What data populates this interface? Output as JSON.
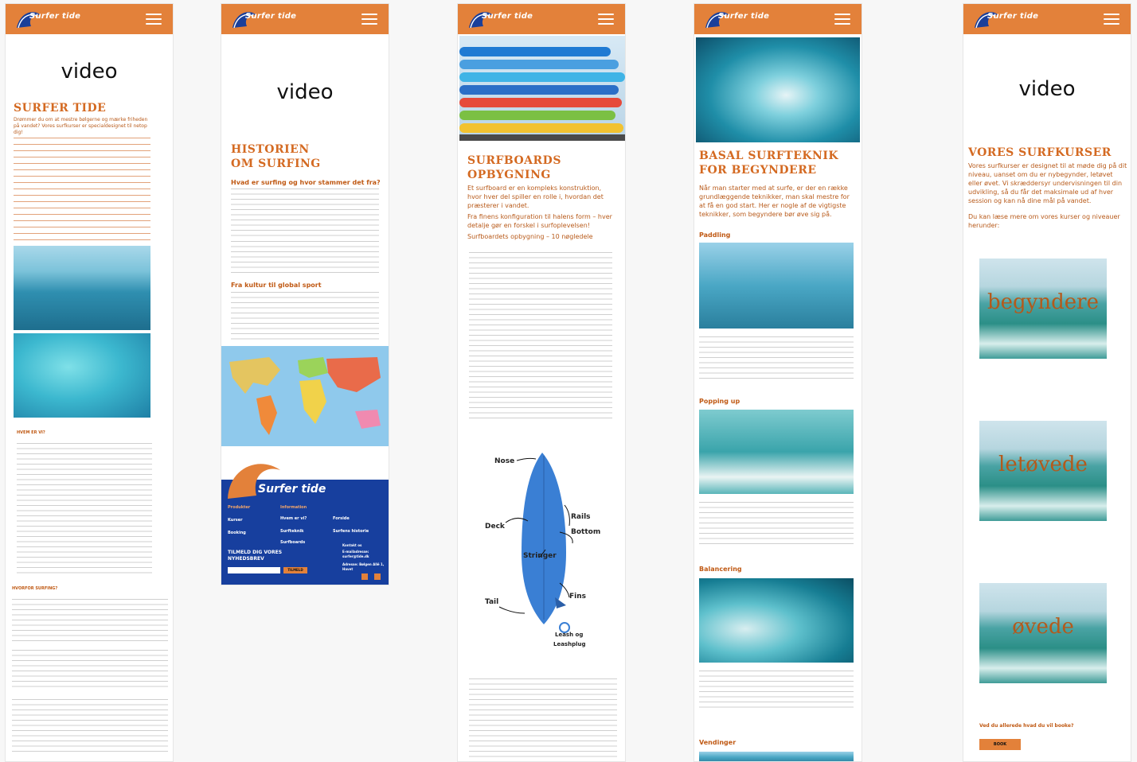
{
  "brand": {
    "name": "Surfer tide"
  },
  "screens": {
    "s1": {
      "video_label": "video",
      "title": "SURFER TIDE",
      "intro": "Drømmer du om at mestre bølgerne og mærke friheden på vandet? Vores surfkurser er specialdesignet til netop dig!",
      "heading_who": "HVEM ER VI?",
      "heading_why": "HVORFOR SURFING?"
    },
    "s2": {
      "video_label": "video",
      "title": "HISTORIEN OM SURFING",
      "sub1": "Hvad er surfing og hvor stammer det fra?",
      "sub2": "Fra kultur til global sport",
      "footer": {
        "col1_head": "Produkter",
        "col1": [
          "Kurser",
          "Booking"
        ],
        "col2_head": "Information",
        "col2": [
          "Hvem er vi?",
          "Surfteknik",
          "Surfboards"
        ],
        "col3": [
          "Forside",
          "Surfens historie"
        ],
        "newsletter": "TILMELD DIG VORES NYHEDSBREV",
        "newsletter_btn": "TILMELD",
        "contact_head": "Kontakt os",
        "email_label": "E-mailadresse:",
        "email": "surfer@tide.dk",
        "address_label": "Adresse: Bølgen Allé 1,",
        "address2": "Havet"
      }
    },
    "s3": {
      "title": "SURFBOARDS OPBYGNING",
      "intro": "Et surfboard er en kompleks konstruktion, hvor hver del spiller en rolle i, hvordan det præsterer i vandet.",
      "intro2": "Fra finens konfiguration til halens form – hver detalje gør en forskel i surfoplevelsen!",
      "intro3": "Surfboardets opbygning – 10 nøgledele",
      "diagram_labels": [
        "Nose",
        "Deck",
        "Rails",
        "Bottom",
        "Stringer",
        "Fins",
        "Tail",
        "Leash og",
        "Leashplug"
      ]
    },
    "s4": {
      "title": "BASAL SURFTEKNIK FOR BEGYNDERE",
      "intro": "Når man starter med at surfe, er der en række grundlæggende teknikker, man skal mestre for at få en god start. Her er nogle af de vigtigste teknikker, som begyndere bør øve sig på.",
      "sections": [
        "Paddling",
        "Popping up",
        "Balancering",
        "Vendinger"
      ]
    },
    "s5": {
      "video_label": "video",
      "title": "VORES SURFKURSER",
      "intro": "Vores surfkurser er designet til at møde dig på dit niveau, uanset om du er nybegynder, letøvet eller øvet. Vi skræddersyr undervisningen til din udvikling, så du får det maksimale ud af hver session og kan nå dine mål på vandet.",
      "intro2": "Du kan læse mere om vores kurser og niveauer herunder:",
      "levels": [
        "begyndere",
        "letøvede",
        "øvede"
      ],
      "question": "Ved du allerede hvad du vil booke?",
      "book_btn": "BOOK"
    }
  },
  "colors": {
    "brand_orange": "#e3813a",
    "footer_blue": "#173f9e",
    "heading_orange": "#d46a22"
  }
}
